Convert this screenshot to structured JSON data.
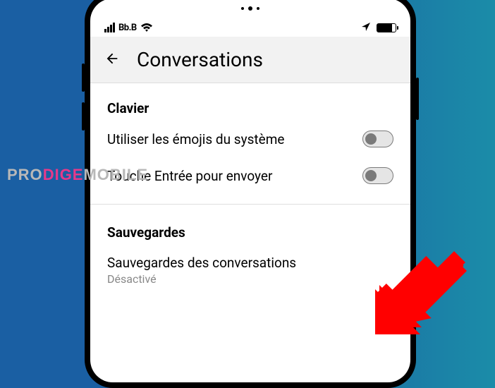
{
  "statusbar": {
    "carrier": "Bb.B"
  },
  "header": {
    "title": "Conversations"
  },
  "sections": {
    "keyboard": {
      "title": "Clavier",
      "emoji_label": "Utiliser les émojis du système",
      "enter_label": "Touche Entrée pour envoyer"
    },
    "backups": {
      "title": "Sauvegardes",
      "chat_backup_label": "Sauvegardes des conversations",
      "chat_backup_status": "Désactivé"
    }
  },
  "watermark": {
    "part1": "PRO",
    "part2": "DIGE",
    "part3": "MOBILE"
  }
}
